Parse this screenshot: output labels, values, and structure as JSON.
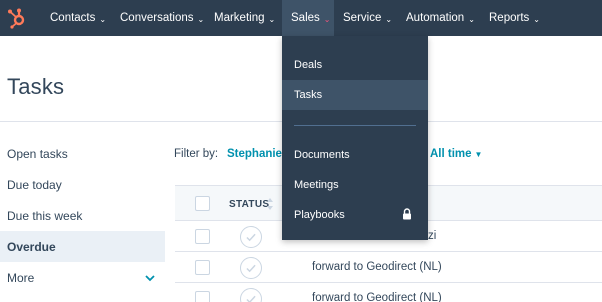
{
  "nav": {
    "items": [
      {
        "label": "Contacts"
      },
      {
        "label": "Conversations"
      },
      {
        "label": "Marketing"
      },
      {
        "label": "Sales"
      },
      {
        "label": "Service"
      },
      {
        "label": "Automation"
      },
      {
        "label": "Reports"
      }
    ],
    "active": "Sales"
  },
  "page": {
    "title": "Tasks"
  },
  "views": {
    "items": [
      {
        "label": "Open tasks"
      },
      {
        "label": "Due today"
      },
      {
        "label": "Due this week"
      },
      {
        "label": "Overdue"
      },
      {
        "label": "More"
      }
    ],
    "active": "Overdue"
  },
  "filters": {
    "label": "Filter by:",
    "owner": "Stephanie I",
    "time": "All time"
  },
  "table": {
    "headers": {
      "status": "STATUS"
    },
    "rows": [
      {
        "title": "zi"
      },
      {
        "title": "forward to Geodirect (NL)"
      },
      {
        "title": "forward to Geodirect (NL)"
      }
    ]
  },
  "sales_menu": {
    "items": [
      {
        "label": "Deals"
      },
      {
        "label": "Tasks"
      },
      {
        "label": "Documents"
      },
      {
        "label": "Meetings"
      },
      {
        "label": "Playbooks",
        "icon": "lock-icon"
      }
    ],
    "active": "Tasks"
  },
  "colors": {
    "nav_bg": "#2d3e50",
    "accent_link": "#0091ae",
    "brand_orange": "#ff7a59",
    "active_view_bg": "#eaf0f6"
  }
}
